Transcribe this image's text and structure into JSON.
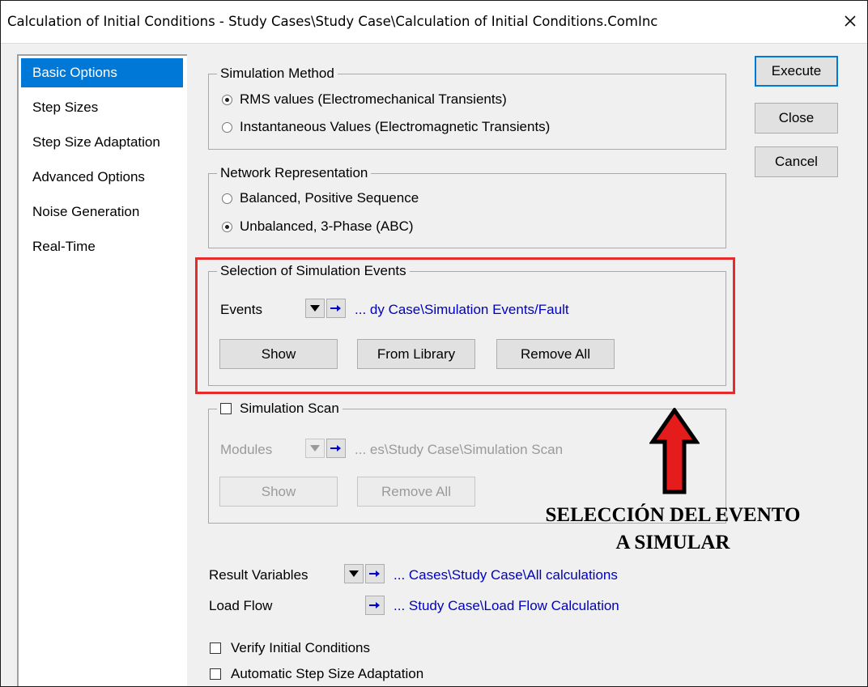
{
  "window": {
    "title": "Calculation of Initial Conditions - Study Cases\\Study Case\\Calculation of Initial Conditions.ComInc",
    "close_glyph": "✕"
  },
  "sidebar": {
    "items": [
      {
        "label": "Basic Options",
        "selected": true
      },
      {
        "label": "Step Sizes"
      },
      {
        "label": "Step Size Adaptation"
      },
      {
        "label": "Advanced Options"
      },
      {
        "label": "Noise Generation"
      },
      {
        "label": "Real-Time"
      }
    ]
  },
  "simulation_method": {
    "title": "Simulation Method",
    "options": [
      {
        "label": "RMS values (Electromechanical Transients)",
        "selected": true
      },
      {
        "label": "Instantaneous Values (Electromagnetic Transients)",
        "selected": false
      }
    ]
  },
  "network_representation": {
    "title": "Network Representation",
    "options": [
      {
        "label": "Balanced, Positive Sequence",
        "selected": false
      },
      {
        "label": "Unbalanced, 3-Phase (ABC)",
        "selected": true
      }
    ]
  },
  "events": {
    "title": "Selection of Simulation Events",
    "label": "Events",
    "path": "... dy Case\\Simulation Events/Fault",
    "buttons": [
      "Show",
      "From Library",
      "Remove All"
    ]
  },
  "scan": {
    "title": "Simulation Scan",
    "checked": false,
    "label": "Modules",
    "path": "... es\\Study Case\\Simulation Scan",
    "buttons": [
      "Show",
      "Remove All"
    ]
  },
  "result_variables": {
    "label": "Result Variables",
    "path": "... Cases\\Study Case\\All calculations"
  },
  "load_flow": {
    "label": "Load Flow",
    "path": "... Study Case\\Load Flow Calculation"
  },
  "checks": [
    {
      "label": "Verify Initial Conditions",
      "checked": false
    },
    {
      "label": "Automatic Step Size Adaptation",
      "checked": false
    }
  ],
  "actions": {
    "execute": "Execute",
    "close": "Close",
    "cancel": "Cancel"
  },
  "annotation": {
    "line1": "SELECCIÓN DEL EVENTO",
    "line2": "A SIMULAR"
  },
  "colors": {
    "accent": "#0078d7",
    "highlight": "#e52b2b",
    "arrow": "#e51c1c",
    "link": "#0000c0"
  }
}
